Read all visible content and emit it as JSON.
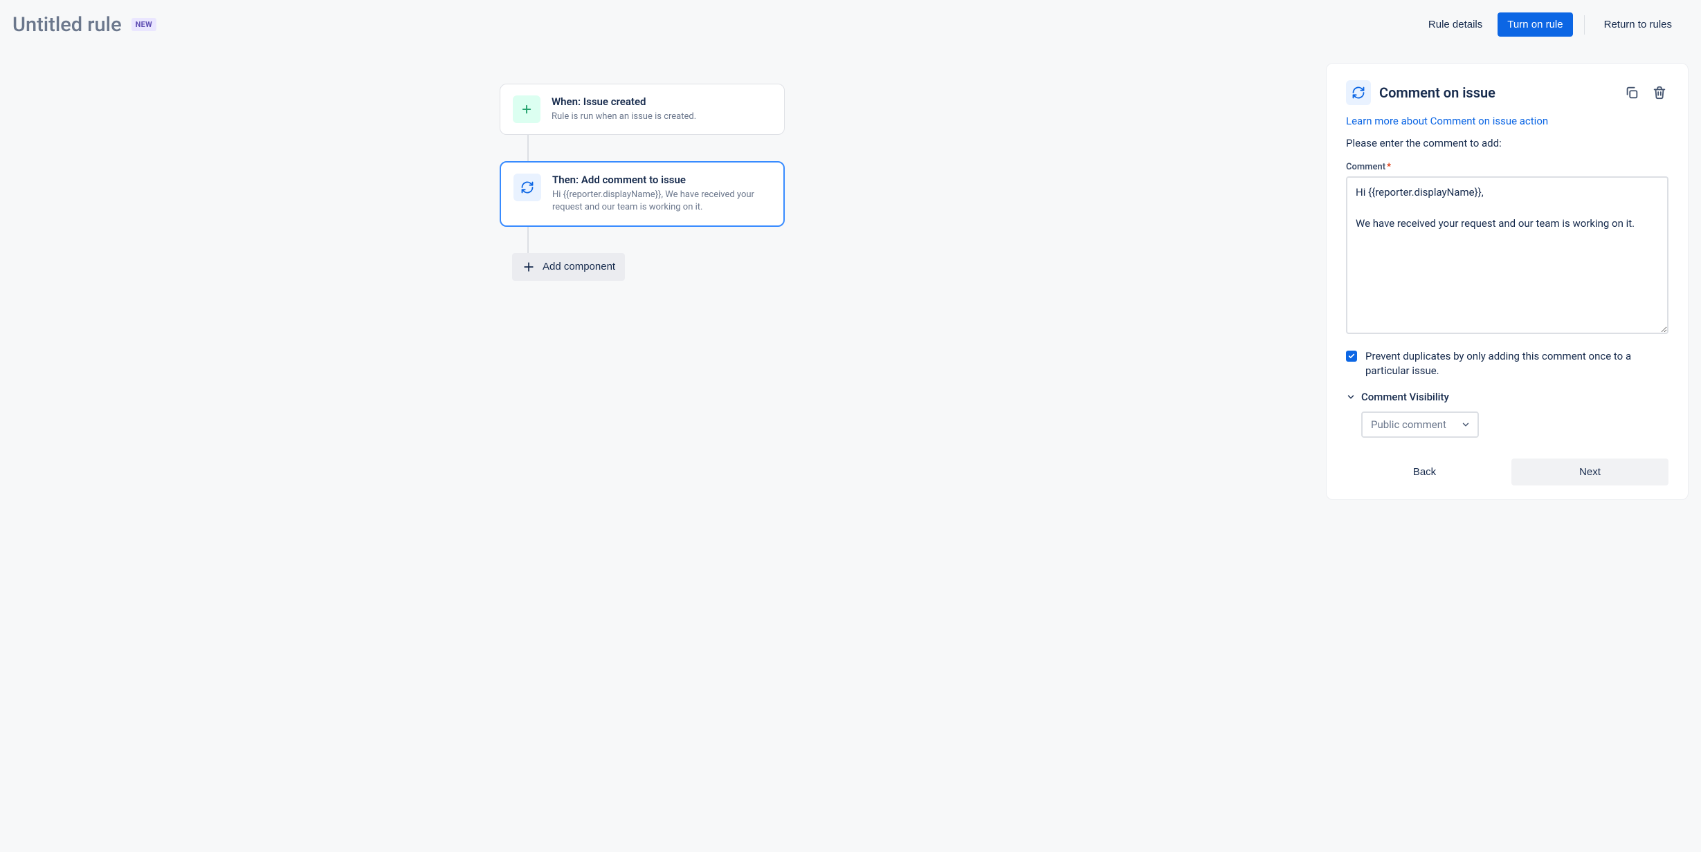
{
  "header": {
    "title": "Untitled rule",
    "badge": "NEW",
    "actions": {
      "details": "Rule details",
      "turn_on": "Turn on rule",
      "return": "Return to rules"
    }
  },
  "flow": {
    "trigger": {
      "title": "When: Issue created",
      "subtitle": "Rule is run when an issue is created."
    },
    "action": {
      "title": "Then: Add comment to issue",
      "subtitle": "Hi {{reporter.displayName}}, We have received your request and our team is working on it."
    },
    "add_component": "Add component"
  },
  "panel": {
    "title": "Comment on issue",
    "learn_more": "Learn more about Comment on issue action",
    "instruction": "Please enter the comment to add:",
    "comment_label": "Comment",
    "comment_value": "Hi {{reporter.displayName}},\n\nWe have received your request and our team is working on it.",
    "prevent_duplicates": "Prevent duplicates by only adding this comment once to a particular issue.",
    "visibility_header": "Comment Visibility",
    "visibility_value": "Public comment",
    "back": "Back",
    "next": "Next"
  },
  "colors": {
    "primary": "#0c66e4",
    "text": "#172b4d",
    "bg": "#f7f8f9"
  }
}
